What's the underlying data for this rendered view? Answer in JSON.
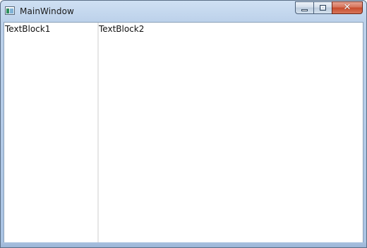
{
  "window": {
    "title": "MainWindow",
    "icon": "app-window-icon"
  },
  "caption_buttons": {
    "minimize_icon": "minimize-icon",
    "maximize_icon": "maximize-icon",
    "close_icon": "close-icon",
    "close_glyph": "✕"
  },
  "content": {
    "textblock1": "TextBlock1",
    "textblock2": "TextBlock2"
  },
  "colors": {
    "close_button": "#c74b2c",
    "frame": "#a9c3e3"
  }
}
